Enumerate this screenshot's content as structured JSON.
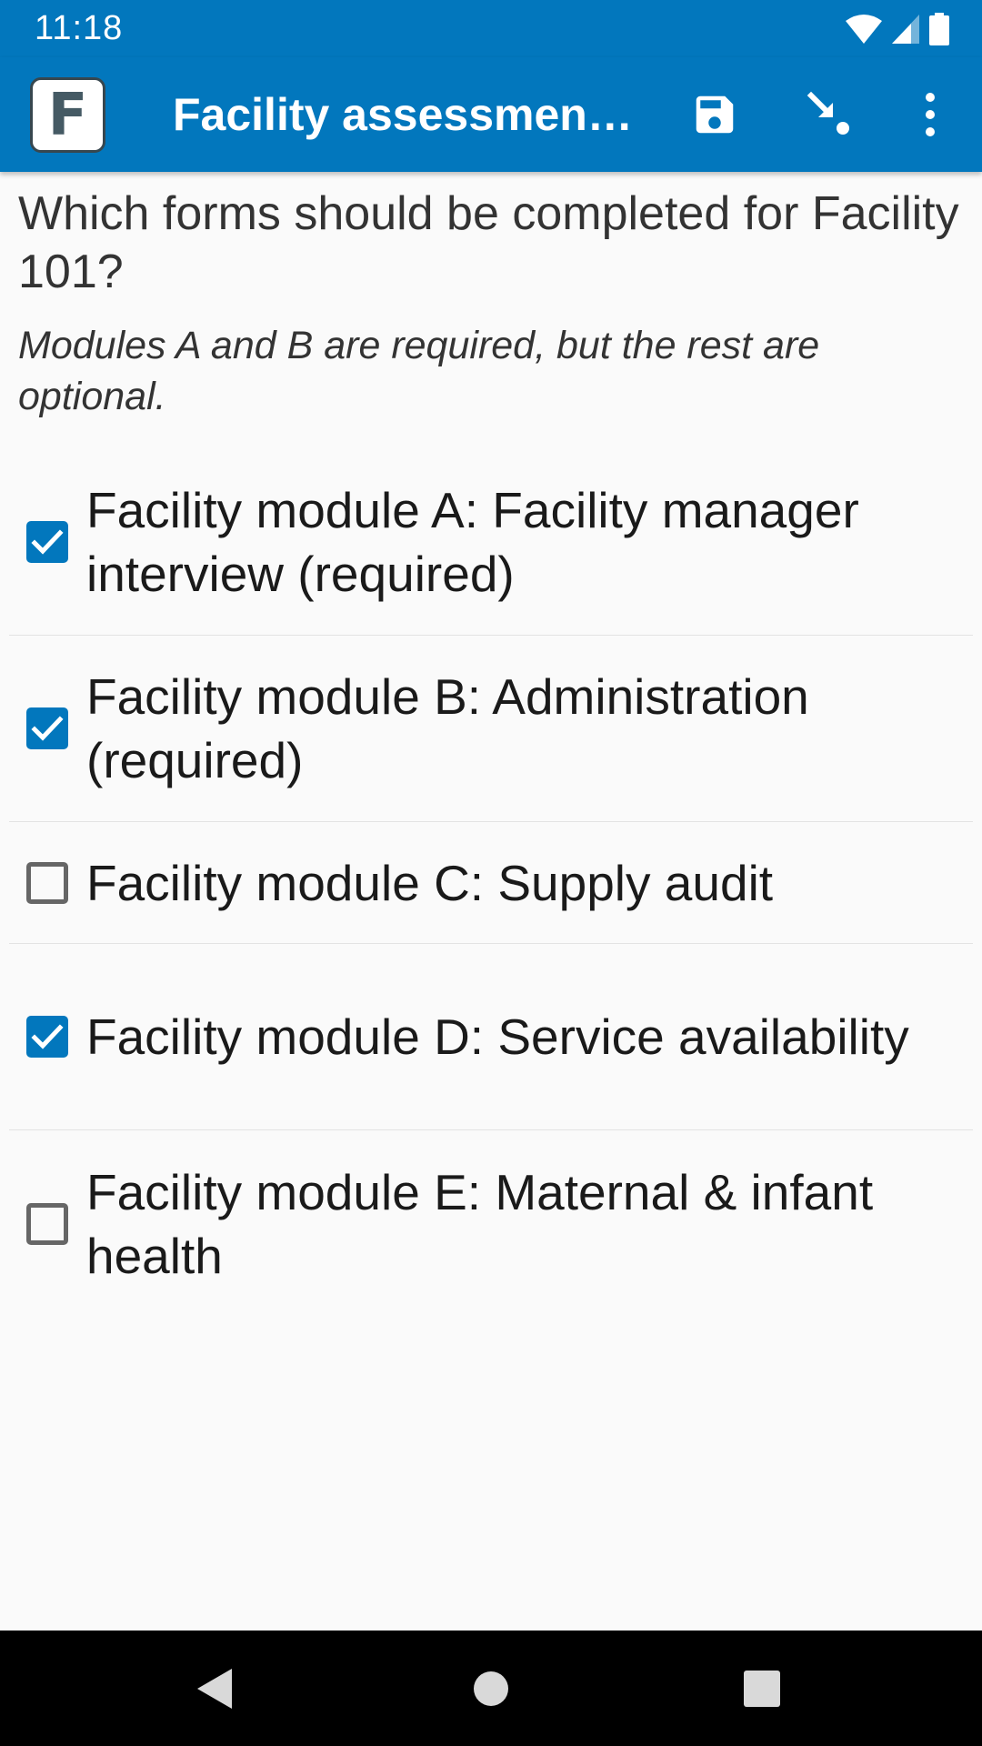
{
  "status_bar": {
    "time": "11:18"
  },
  "app_bar": {
    "logo_letter": "F",
    "title": "Facility assessmen…",
    "actions": [
      "save-icon",
      "jump-icon",
      "more-vertical-icon"
    ]
  },
  "question": {
    "label": "Which forms should be completed for Facility 101?",
    "hint": "Modules A and B are required, but the rest are optional."
  },
  "options": [
    {
      "label": "Facility module A: Facility manager interview (required)",
      "checked": true
    },
    {
      "label": "Facility module B: Administration (required)",
      "checked": true
    },
    {
      "label": "Facility module C: Supply audit",
      "checked": false
    },
    {
      "label": "Facility module D: Service availability",
      "checked": true
    },
    {
      "label": "Facility module E: Maternal & infant health",
      "checked": false
    }
  ],
  "colors": {
    "primary": "#0277bd",
    "checkbox_checked": "#0277bd",
    "checkbox_unchecked": "#666666",
    "background": "#fafafa",
    "nav_bar": "#000000"
  },
  "nav_bar": {
    "buttons": [
      "back-icon",
      "home-icon",
      "recents-icon"
    ]
  }
}
